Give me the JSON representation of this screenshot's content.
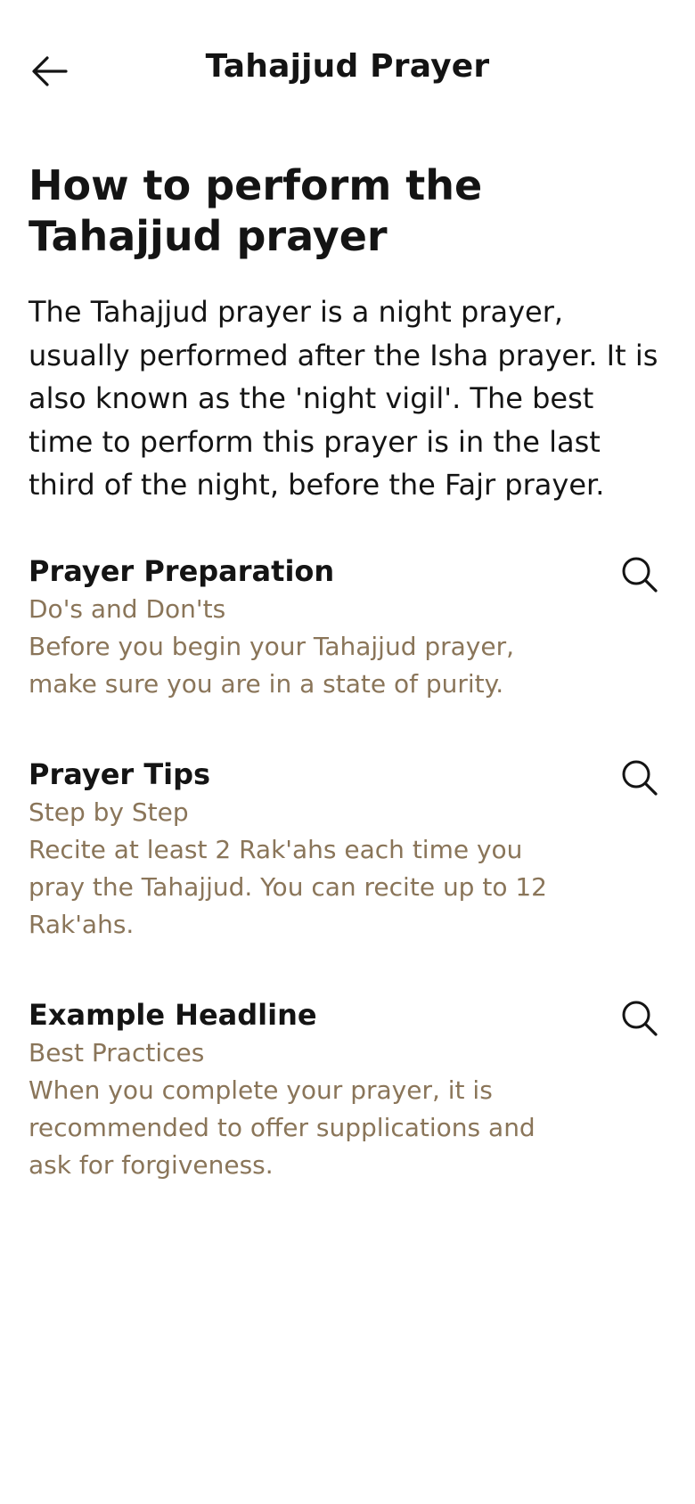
{
  "header": {
    "title": "Tahajjud Prayer",
    "back_icon": "arrow-left-icon"
  },
  "article": {
    "headline": "How to perform the Tahajjud prayer",
    "intro": "The Tahajjud prayer is a night prayer, usually performed after the Isha prayer. It is also known as the 'night vigil'. The best time to perform this prayer is in the last third of the night, before the Fajr prayer."
  },
  "sections": [
    {
      "title": "Prayer Preparation",
      "subtitle": "Do's and Don'ts",
      "body": "Before you begin your Tahajjud prayer, make sure you are in a state of purity.",
      "icon": "search-icon"
    },
    {
      "title": "Prayer Tips",
      "subtitle": "Step by Step",
      "body": "Recite at least 2 Rak'ahs each time you pray the Tahajjud. You can recite up to 12 Rak'ahs.",
      "icon": "search-icon"
    },
    {
      "title": "Example Headline",
      "subtitle": "Best Practices",
      "body": "When you complete your prayer, it is recommended to offer supplications and ask for forgiveness.",
      "icon": "search-icon"
    }
  ],
  "colors": {
    "text_primary": "#141414",
    "text_secondary": "#8a7559",
    "background": "#ffffff"
  }
}
